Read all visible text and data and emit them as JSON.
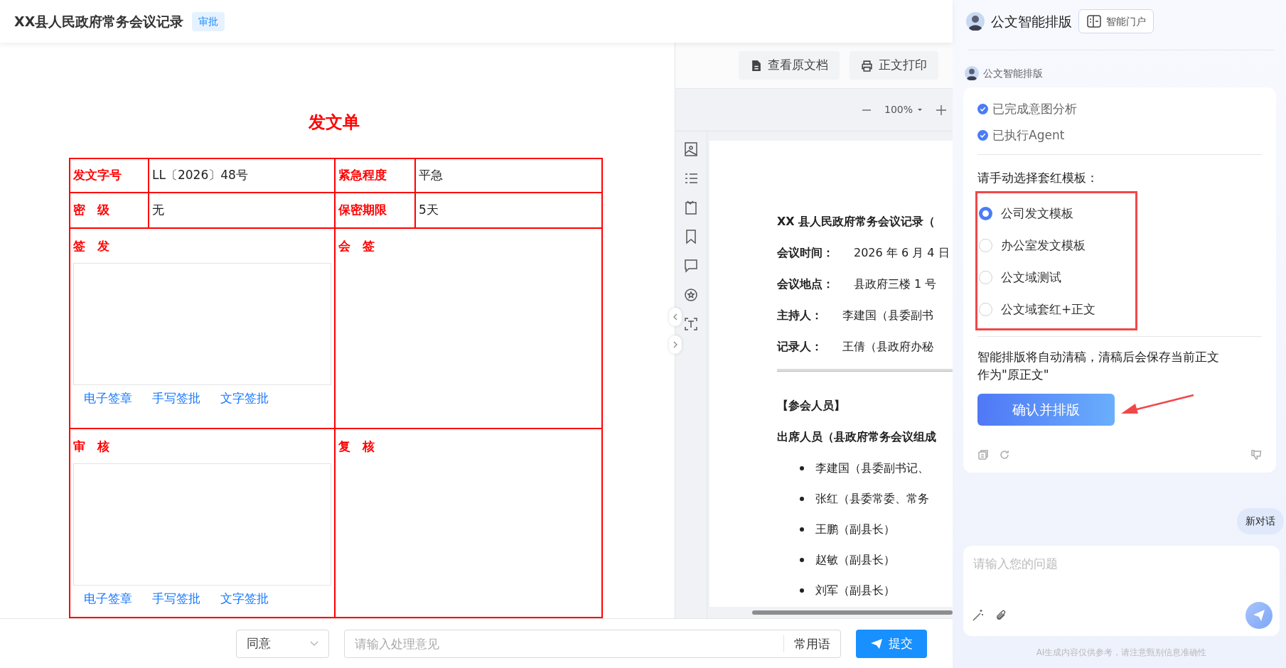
{
  "header": {
    "title": "XX县人民政府常务会议记录",
    "badge": "审批"
  },
  "form": {
    "title": "发文单",
    "rows": [
      [
        {
          "label": "发文字号",
          "value": "LL〔2026〕48号"
        },
        {
          "label": "紧急程度",
          "value": "平急"
        }
      ],
      [
        {
          "label": "密　级",
          "value": "无"
        },
        {
          "label": "保密期限",
          "value": "5天"
        }
      ]
    ],
    "sections": [
      [
        {
          "label": "签　发",
          "sign_actions": [
            "电子签章",
            "手写签批",
            "文字签批"
          ]
        },
        {
          "label": "会　签"
        }
      ],
      [
        {
          "label": "审　核",
          "sign_actions": [
            "电子签章",
            "手写签批",
            "文字签批"
          ]
        },
        {
          "label": "复　核"
        }
      ]
    ]
  },
  "doc_toolbar": {
    "buttons": [
      "查看原文档",
      "正文打印"
    ],
    "zoom": "100%"
  },
  "document": {
    "title": "XX 县人民政府常务会议记录（",
    "meta": [
      {
        "label": "会议时间：",
        "value": "2026 年 6 月 4 日"
      },
      {
        "label": "会议地点：",
        "value": "县政府三楼 1 号"
      },
      {
        "label": "主持人：",
        "value": "李建国（县委副书"
      },
      {
        "label": "记录人：",
        "value": "王倩（县政府办秘"
      }
    ],
    "section": "【参会人员】",
    "subheading": "出席人员（县政府常务会议组成",
    "attendees": [
      "李建国（县委副书记、",
      "张红（县委常委、常务",
      "王鹏（副县长）",
      "赵敏（副县长）",
      "刘军（副县长）"
    ]
  },
  "action_bar": {
    "opinion": "同意",
    "opinion_placeholder": "请输入处理意见",
    "phrases_button": "常用语",
    "submit_button": "提交"
  },
  "assistant": {
    "title": "公文智能排版",
    "portal_button": "智能门户",
    "message": {
      "sender": "公文智能排版",
      "steps": [
        {
          "label": "已完成意图分析",
          "done": true
        },
        {
          "label": "已执行Agent",
          "done": true
        }
      ],
      "prompt": "请手动选择套红模板：",
      "options": [
        {
          "label": "公司发文模板",
          "selected": true
        },
        {
          "label": "办公室发文模板",
          "selected": false
        },
        {
          "label": "公文域测试",
          "selected": false
        },
        {
          "label": "公文域套红+正文",
          "selected": false
        }
      ],
      "note": "智能排版将自动清稿，清稿后会保存当前正文作为\"原正文\"",
      "confirm_button": "确认并排版"
    },
    "new_chat": "新对话",
    "input": {
      "placeholder": "请输入您的问题"
    },
    "disclaimer": "AI生成内容仅供参考，请注意甄别信息准确性"
  }
}
